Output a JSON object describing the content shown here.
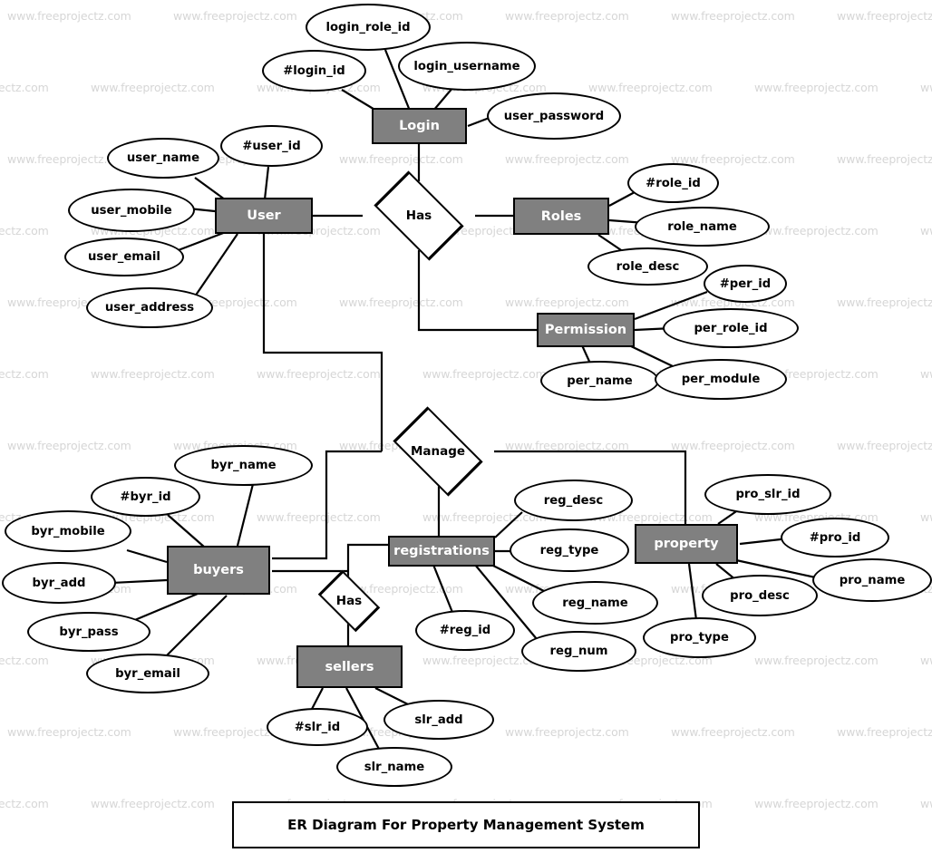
{
  "diagram": {
    "caption": "ER Diagram For Property Management System",
    "watermark_text": "www.freeprojectz.com",
    "colors": {
      "entity_fill": "#808080",
      "entity_border": "#000000",
      "entity_text": "#ffffff",
      "attribute_fill": "#ffffff",
      "attribute_border": "#000000",
      "attribute_text": "#000000",
      "relationship_fill": "#ffffff",
      "line": "#000000",
      "watermark": "#d6d6d6",
      "background": "#ffffff"
    },
    "entities": [
      {
        "id": "login",
        "label": "Login"
      },
      {
        "id": "user",
        "label": "User"
      },
      {
        "id": "roles",
        "label": "Roles"
      },
      {
        "id": "permission",
        "label": "Permission"
      },
      {
        "id": "buyers",
        "label": "buyers"
      },
      {
        "id": "registrations",
        "label": "registrations"
      },
      {
        "id": "property",
        "label": "property"
      },
      {
        "id": "sellers",
        "label": "sellers"
      }
    ],
    "relationships": [
      {
        "id": "has_user_roles",
        "label": "Has"
      },
      {
        "id": "manage",
        "label": "Manage"
      },
      {
        "id": "has_registr_sellers",
        "label": "Has"
      }
    ],
    "attributes": {
      "login": [
        "login_role_id",
        "#login_id",
        "login_username",
        "user_password"
      ],
      "user": [
        "user_name",
        "#user_id",
        "user_mobile",
        "user_email",
        "user_address"
      ],
      "roles": [
        "#role_id",
        "role_name",
        "role_desc"
      ],
      "permission": [
        "#per_id",
        "per_role_id",
        "per_name",
        "per_module"
      ],
      "buyers": [
        "byr_name",
        "#byr_id",
        "byr_mobile",
        "byr_add",
        "byr_pass",
        "byr_email"
      ],
      "registrations": [
        "reg_desc",
        "reg_type",
        "reg_name",
        "reg_num",
        "#reg_id"
      ],
      "property": [
        "pro_slr_id",
        "#pro_id",
        "pro_name",
        "pro_desc",
        "pro_type"
      ],
      "sellers": [
        "#slr_id",
        "slr_add",
        "slr_name"
      ]
    },
    "labels": {
      "login_role_id": "login_role_id",
      "login_id": "#login_id",
      "login_username": "login_username",
      "user_password": "user_password",
      "login": "Login",
      "user_name": "user_name",
      "user_id": "#user_id",
      "user_mobile": "user_mobile",
      "user_email": "user_email",
      "user_address": "user_address",
      "user": "User",
      "has1": "Has",
      "roles": "Roles",
      "role_id": "#role_id",
      "role_name": "role_name",
      "role_desc": "role_desc",
      "permission": "Permission",
      "per_id": "#per_id",
      "per_role_id": "per_role_id",
      "per_name": "per_name",
      "per_module": "per_module",
      "manage": "Manage",
      "byr_name": "byr_name",
      "byr_id": "#byr_id",
      "byr_mobile": "byr_mobile",
      "byr_add": "byr_add",
      "byr_pass": "byr_pass",
      "byr_email": "byr_email",
      "buyers": "buyers",
      "registrations": "registrations",
      "reg_desc": "reg_desc",
      "reg_type": "reg_type",
      "reg_name": "reg_name",
      "reg_num": "reg_num",
      "reg_id": "#reg_id",
      "property": "property",
      "pro_slr_id": "pro_slr_id",
      "pro_id": "#pro_id",
      "pro_name": "pro_name",
      "pro_desc": "pro_desc",
      "pro_type": "pro_type",
      "has2": "Has",
      "sellers": "sellers",
      "slr_id": "#slr_id",
      "slr_add": "slr_add",
      "slr_name": "slr_name"
    }
  }
}
